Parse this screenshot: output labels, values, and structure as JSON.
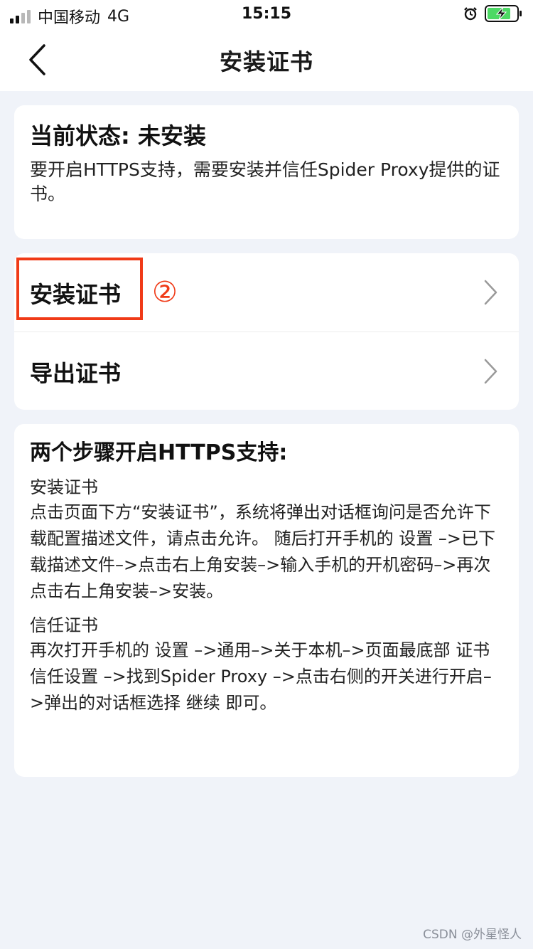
{
  "status_bar": {
    "carrier": "中国移动",
    "network": "4G",
    "time": "15:15"
  },
  "nav": {
    "title": "安装证书"
  },
  "status_card": {
    "title": "当前状态: 未安装",
    "description": "要开启HTTPS支持，需要安装并信任Spider Proxy提供的证书。"
  },
  "menu": {
    "items": [
      {
        "label": "安装证书",
        "icon": "chevron-right-icon"
      },
      {
        "label": "导出证书",
        "icon": "chevron-right-icon"
      }
    ],
    "annotation_marker": "②"
  },
  "steps_card": {
    "title": "两个步骤开启HTTPS支持:",
    "steps": [
      {
        "heading": "安装证书",
        "text": "点击页面下方“安装证书”，系统将弹出对话框询问是否允许下载配置描述文件，请点击允许。 随后打开手机的 设置 –>已下载描述文件–>点击右上角安装–>输入手机的开机密码–>再次点击右上角安装–>安装。"
      },
      {
        "heading": "信任证书",
        "text": "再次打开手机的 设置 –>通用–>关于本机–>页面最底部 证书信任设置 –>找到Spider Proxy –>点击右侧的开关进行开启–>弹出的对话框选择 继续 即可。"
      }
    ]
  },
  "watermark": "CSDN @外星怪人",
  "colors": {
    "background": "#f0f3f9",
    "card": "#ffffff",
    "annotation_red": "#f03a17",
    "battery_green": "#4cd964"
  }
}
